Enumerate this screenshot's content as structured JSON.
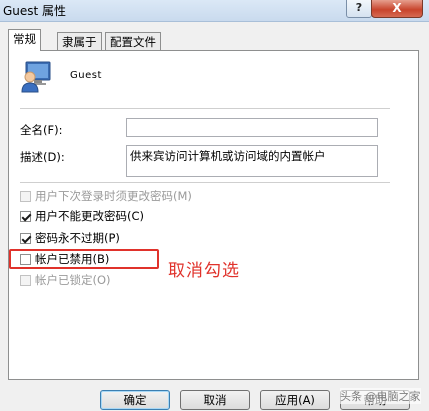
{
  "window": {
    "title": "Guest 属性",
    "help_glyph": "?",
    "close_glyph": "X"
  },
  "tabs": [
    {
      "label": "常规",
      "active": true
    },
    {
      "label": "隶属于",
      "active": false
    },
    {
      "label": "配置文件",
      "active": false
    }
  ],
  "user": {
    "name": "Guest",
    "icon": "user-account-icon"
  },
  "form": {
    "fullname_label": "全名(F):",
    "fullname_value": "",
    "description_label": "描述(D):",
    "description_value": "供来宾访问计算机或访问域的内置帐户"
  },
  "options": [
    {
      "label": "用户下次登录时须更改密码(M)",
      "checked": false,
      "disabled": true
    },
    {
      "label": "用户不能更改密码(C)",
      "checked": true,
      "disabled": false
    },
    {
      "label": "密码永不过期(P)",
      "checked": true,
      "disabled": false
    },
    {
      "label": "帐户已禁用(B)",
      "checked": false,
      "disabled": false
    },
    {
      "label": "帐户已锁定(O)",
      "checked": false,
      "disabled": true
    }
  ],
  "annotation": {
    "text": "取消勾选",
    "color": "#e0322b"
  },
  "buttons": {
    "ok": "确定",
    "cancel": "取消",
    "apply": "应用(A)",
    "help": "帮助"
  },
  "watermark": "头条 @电脑之家"
}
